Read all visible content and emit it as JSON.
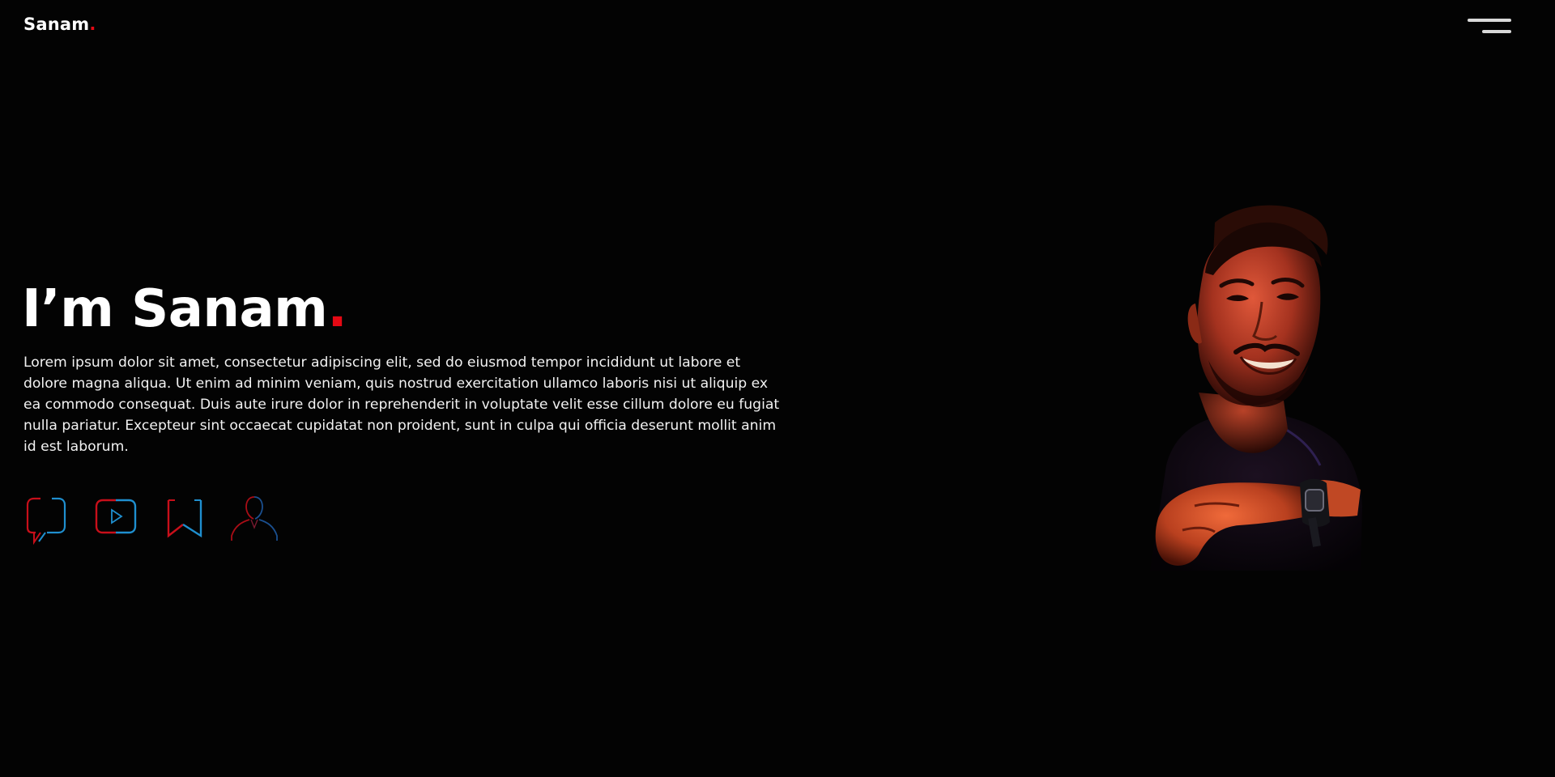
{
  "brand": {
    "name": "Sanam",
    "dot": "."
  },
  "header": {
    "menu_icon": "hamburger-menu-icon"
  },
  "hero": {
    "title_prefix": "I’m Sanam",
    "title_dot": ".",
    "description": "Lorem ipsum dolor sit amet, consectetur adipiscing elit, sed do eiusmod tempor incididunt ut labore et dolore magna aliqua. Ut enim ad minim veniam, quis nostrud exercitation ullamco laboris nisi ut aliquip ex ea commodo consequat. Duis aute irure dolor in reprehenderit in voluptate velit esse cillum dolore eu fugiat nulla pariatur. Excepteur sint occaecat cupidatat non proident, sunt in culpa qui officia deserunt mollit anim id est laborum."
  },
  "socials": [
    {
      "icon": "chat-bubble-icon"
    },
    {
      "icon": "youtube-play-icon"
    },
    {
      "icon": "bookmark-icon"
    },
    {
      "icon": "person-profile-icon"
    }
  ],
  "portrait": {
    "icon": "profile-photo"
  },
  "colors": {
    "accent": "#e50914",
    "background": "#030303",
    "text": "#ffffff",
    "icon_red": "#c80f1a",
    "icon_blue": "#1f8fcf",
    "menu_bar": "#d9d9d9"
  }
}
